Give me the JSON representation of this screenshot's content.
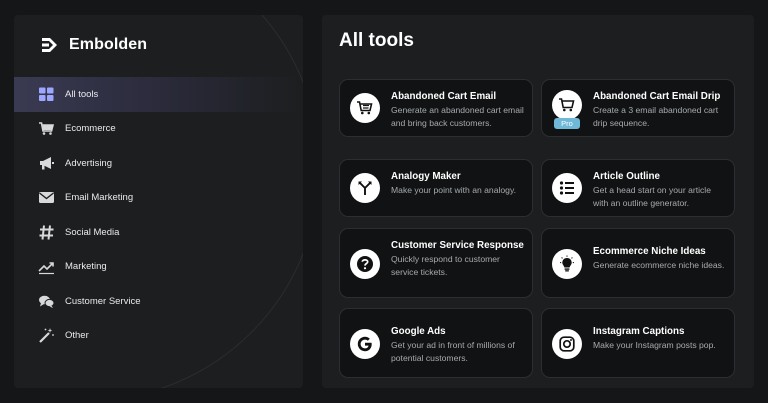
{
  "brand": {
    "name": "Embolden",
    "icon": "embolden-logo"
  },
  "sidebar": {
    "items": [
      {
        "label": "All tools",
        "icon": "grid-icon",
        "active": true
      },
      {
        "label": "Ecommerce",
        "icon": "cart-icon"
      },
      {
        "label": "Advertising",
        "icon": "megaphone-icon"
      },
      {
        "label": "Email Marketing",
        "icon": "envelope-icon"
      },
      {
        "label": "Social Media",
        "icon": "hashtag-icon"
      },
      {
        "label": "Marketing",
        "icon": "trend-icon"
      },
      {
        "label": "Customer Service",
        "icon": "chat-icon"
      },
      {
        "label": "Other",
        "icon": "magic-wand-icon"
      }
    ]
  },
  "main": {
    "title": "All tools",
    "tools": [
      {
        "title": "Abandoned Cart Email",
        "desc": "Generate an abandoned cart email and bring back customers.",
        "icon": "cart-icon"
      },
      {
        "title": "Abandoned Cart Email Drip",
        "desc": "Create a 3 email abandoned cart drip sequence.",
        "icon": "cart-icon",
        "badge": "Pro"
      },
      {
        "title": "Analogy Maker",
        "desc": "Make your point with an analogy.",
        "icon": "split-arrow-icon"
      },
      {
        "title": "Article Outline",
        "desc": "Get a head start on your article with an outline generator.",
        "icon": "list-icon"
      },
      {
        "title": "Customer Service Response",
        "desc": "Quickly respond to customer service tickets.",
        "icon": "question-icon"
      },
      {
        "title": "Ecommerce Niche Ideas",
        "desc": "Generate ecommerce niche ideas.",
        "icon": "lightbulb-icon"
      },
      {
        "title": "Google Ads",
        "desc": "Get your ad in front of millions of potential customers.",
        "icon": "google-icon"
      },
      {
        "title": "Instagram Captions",
        "desc": "Make your Instagram posts pop.",
        "icon": "instagram-icon"
      }
    ]
  },
  "colors": {
    "accent": "#3a3a52",
    "card_bg": "#111213",
    "panel_bg": "#1c1e1f",
    "pro_badge": "#6fb8d8"
  }
}
